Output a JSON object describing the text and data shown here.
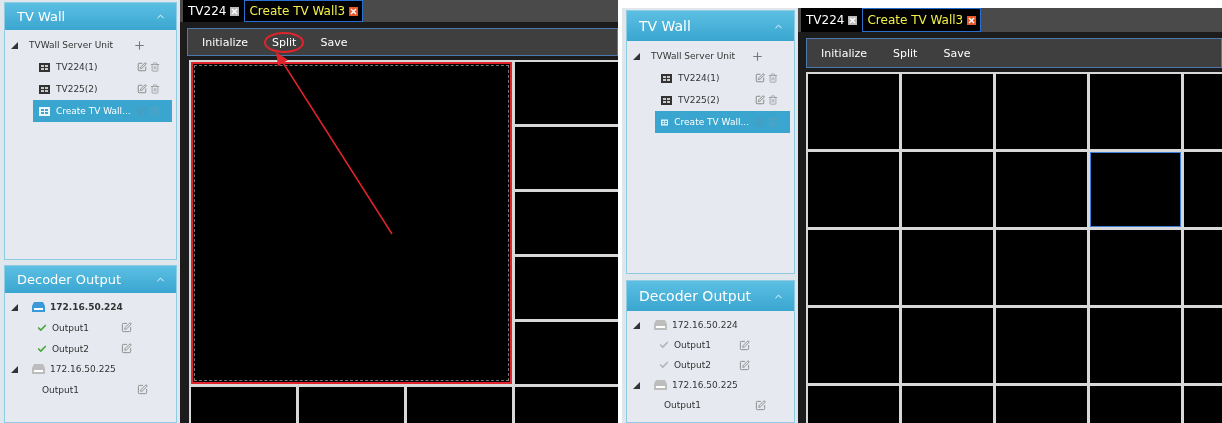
{
  "screens": [
    {
      "sidebar": {
        "tv_wall": {
          "title": "TV Wall",
          "expanded": true,
          "root": {
            "label": "TVWall Server Unit",
            "expanded": true,
            "children": [
              {
                "label": "TV224(1)",
                "selected": false
              },
              {
                "label": "TV225(2)",
                "selected": false
              },
              {
                "label": "Create TV Wall...",
                "selected": true
              }
            ]
          }
        },
        "decoder_output": {
          "title": "Decoder Output",
          "expanded": true,
          "devices": [
            {
              "label": "172.16.50.224",
              "online": true,
              "expanded": true,
              "outputs": [
                {
                  "label": "Output1",
                  "checked": true
                },
                {
                  "label": "Output2",
                  "checked": true
                }
              ]
            },
            {
              "label": "172.16.50.225",
              "online": false,
              "expanded": true,
              "outputs": [
                {
                  "label": "Output1",
                  "checked": false
                }
              ]
            }
          ]
        }
      },
      "tabs": [
        {
          "label": "TV224",
          "selected": false
        },
        {
          "label": "Create TV Wall3",
          "selected": true
        }
      ],
      "toolbar": [
        {
          "label": "Initialize",
          "highlighted": false
        },
        {
          "label": "Split",
          "highlighted": true
        },
        {
          "label": "Save",
          "highlighted": false
        }
      ],
      "grid": {
        "kind": "merged",
        "cells": [
          {
            "selected": true
          },
          {
            "selected": false
          },
          {
            "selected": false
          },
          {
            "selected": false
          },
          {
            "selected": false
          },
          {
            "selected": false
          },
          {
            "selected": false
          },
          {
            "selected": false
          },
          {
            "selected": false
          },
          {
            "selected": false
          }
        ]
      }
    },
    {
      "sidebar": {
        "tv_wall": {
          "title": "TV Wall",
          "expanded": true,
          "root": {
            "label": "TVWall Server Unit",
            "expanded": true,
            "children": [
              {
                "label": "TV224(1)",
                "selected": false
              },
              {
                "label": "TV225(2)",
                "selected": false
              },
              {
                "label": "Create TV Wall...",
                "selected": true
              }
            ]
          }
        },
        "decoder_output": {
          "title": "Decoder Output",
          "expanded": true,
          "devices": [
            {
              "label": "172.16.50.224",
              "online": false,
              "expanded": true,
              "outputs": [
                {
                  "label": "Output1",
                  "checked": true
                },
                {
                  "label": "Output2",
                  "checked": true
                }
              ]
            },
            {
              "label": "172.16.50.225",
              "online": false,
              "expanded": true,
              "outputs": [
                {
                  "label": "Output1",
                  "checked": false
                }
              ]
            }
          ]
        }
      },
      "tabs": [
        {
          "label": "TV224",
          "selected": false
        },
        {
          "label": "Create TV Wall3",
          "selected": true
        }
      ],
      "toolbar": [
        {
          "label": "Initialize",
          "highlighted": false
        },
        {
          "label": "Split",
          "highlighted": false
        },
        {
          "label": "Save",
          "highlighted": false
        }
      ],
      "grid": {
        "kind": "uniform",
        "cells": [
          {
            "selected": false
          },
          {
            "selected": false
          },
          {
            "selected": false
          },
          {
            "selected": false
          },
          {
            "selected": false
          },
          {
            "selected": false
          },
          {
            "selected": false
          },
          {
            "selected": false
          },
          {
            "selected": true
          },
          {
            "selected": false
          },
          {
            "selected": false
          },
          {
            "selected": false
          },
          {
            "selected": false
          },
          {
            "selected": false
          },
          {
            "selected": false
          },
          {
            "selected": false
          },
          {
            "selected": false
          },
          {
            "selected": false
          },
          {
            "selected": false
          },
          {
            "selected": false
          },
          {
            "selected": false
          },
          {
            "selected": false
          },
          {
            "selected": false
          },
          {
            "selected": false
          },
          {
            "selected": false
          }
        ]
      }
    }
  ]
}
